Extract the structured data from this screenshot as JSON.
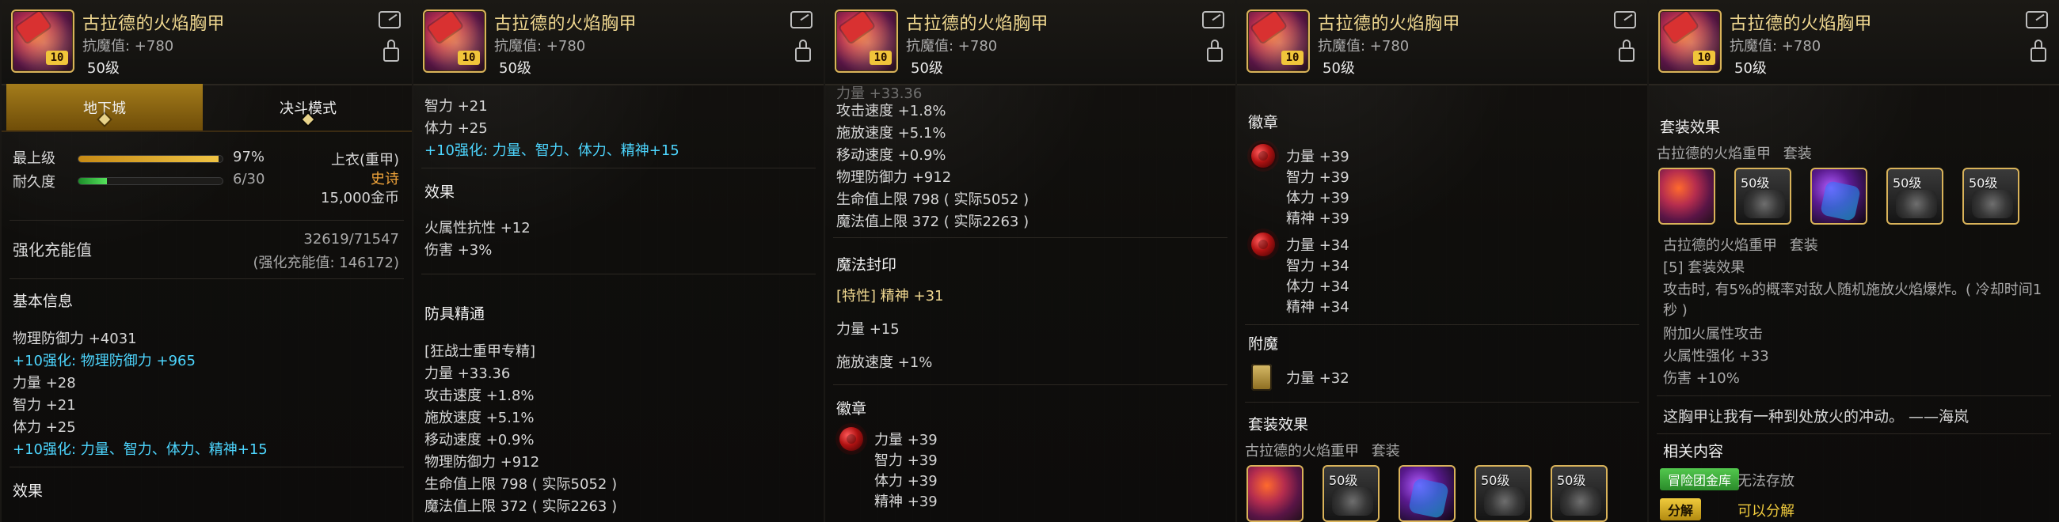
{
  "common": {
    "item_title": "古拉德的火焰胸甲",
    "item_sub": "抗魔值: +780",
    "item_level": "50级"
  },
  "panel1": {
    "tabs": [
      "地下城",
      "决斗模式"
    ],
    "top": {
      "top_label": "最上级",
      "top_value": "97%",
      "dur_label": "耐久度",
      "dur_value": "6/30",
      "type": "上衣(重甲)",
      "rarity": "史诗",
      "price": "15,000金币",
      "top_fill": 0.97,
      "dur_fill": 0.2
    },
    "enhance": {
      "label": "强化充能值",
      "value": "32619/71547",
      "note": "(强化充能值: 146172)"
    },
    "basic": {
      "title": "基本信息",
      "lines": [
        "物理防御力 +4031",
        "+10强化: 物理防御力 +965",
        "力量 +28",
        "智力 +21",
        "体力 +25",
        "+10强化: 力量、智力、体力、精神+15"
      ],
      "footer": "效果"
    }
  },
  "panel2": {
    "top_lines": [
      "智力 +21",
      "体力 +25",
      "+10强化: 力量、智力、体力、精神+15"
    ],
    "effect_title": "效果",
    "effect_lines": [
      "火属性抗性 +12",
      "伤害 +3%"
    ],
    "mastery_title": "防具精通",
    "mastery_tag": "[狂战士重甲专精]",
    "mastery_lines": [
      "力量 +33.36",
      "攻击速度 +1.8%",
      "施放速度 +5.1%",
      "移动速度 +0.9%",
      "物理防御力 +912",
      "生命值上限 798 ( 实际5052 )",
      "魔法值上限 372 ( 实际2263 )"
    ]
  },
  "panel3": {
    "top_partial": "力量 +33.36",
    "top_lines": [
      "攻击速度 +1.8%",
      "施放速度 +5.1%",
      "移动速度 +0.9%",
      "物理防御力 +912",
      "生命值上限 798 ( 实际5052 )",
      "魔法值上限 372 ( 实际2263 )"
    ],
    "seal_title": "魔法封印",
    "seal_line1": "[特性] 精神 +31",
    "seal_line2": "力量 +15",
    "seal_line3": "施放速度 +1%",
    "emblem_title": "徽章",
    "emblem_stats": [
      "力量 +39",
      "智力 +39",
      "体力 +39",
      "精神 +39"
    ]
  },
  "panel4": {
    "emblem_title": "徽章",
    "emblem1": [
      "力量 +39",
      "智力 +39",
      "体力 +39",
      "精神 +39"
    ],
    "emblem2": [
      "力量 +34",
      "智力 +34",
      "体力 +34",
      "精神 +34"
    ],
    "enchant_title": "附魔",
    "enchant_line": "力量 +32",
    "set_title": "套装效果",
    "set_name": "古拉德的火焰重甲",
    "set_suffix": "套装",
    "set_items": [
      "",
      "50级",
      "",
      "50级",
      "50级"
    ]
  },
  "panel5": {
    "set_title": "套装效果",
    "set_name": "古拉德的火焰重甲",
    "set_suffix": "套装",
    "set_items": [
      "",
      "50级",
      "",
      "50级",
      "50级"
    ],
    "set_name2": "古拉德的火焰重甲",
    "set_suffix2": "套装",
    "set_count": "[5] 套装效果",
    "desc": "攻击时, 有5%的概率对敌人随机施放火焰爆炸。( 冷却时间1秒 )",
    "desc_line1": "攻击时, 有5%的概率对敌人随机施放火焰爆炸。( 冷却时间1",
    "desc_line2": "秒 )",
    "extra_lines": [
      "附加火属性攻击",
      "火属性强化 +33",
      "伤害 +10%"
    ],
    "quote": "这胸甲让我有一种到处放火的冲动。 ——海岚",
    "related_title": "相关内容",
    "tags": [
      {
        "label": "冒险团金库",
        "value": "无法存放",
        "color": "green"
      },
      {
        "label": "分解",
        "value": "可以分解",
        "color": "yellow"
      }
    ]
  },
  "colors": {
    "gold": "#f0d890",
    "cyan": "#4dd6ff",
    "orange": "#f0a43a"
  },
  "icons": {
    "share": "share-icon",
    "lock": "lock-icon",
    "emblem": "emblem-icon",
    "enchant": "card-icon"
  }
}
